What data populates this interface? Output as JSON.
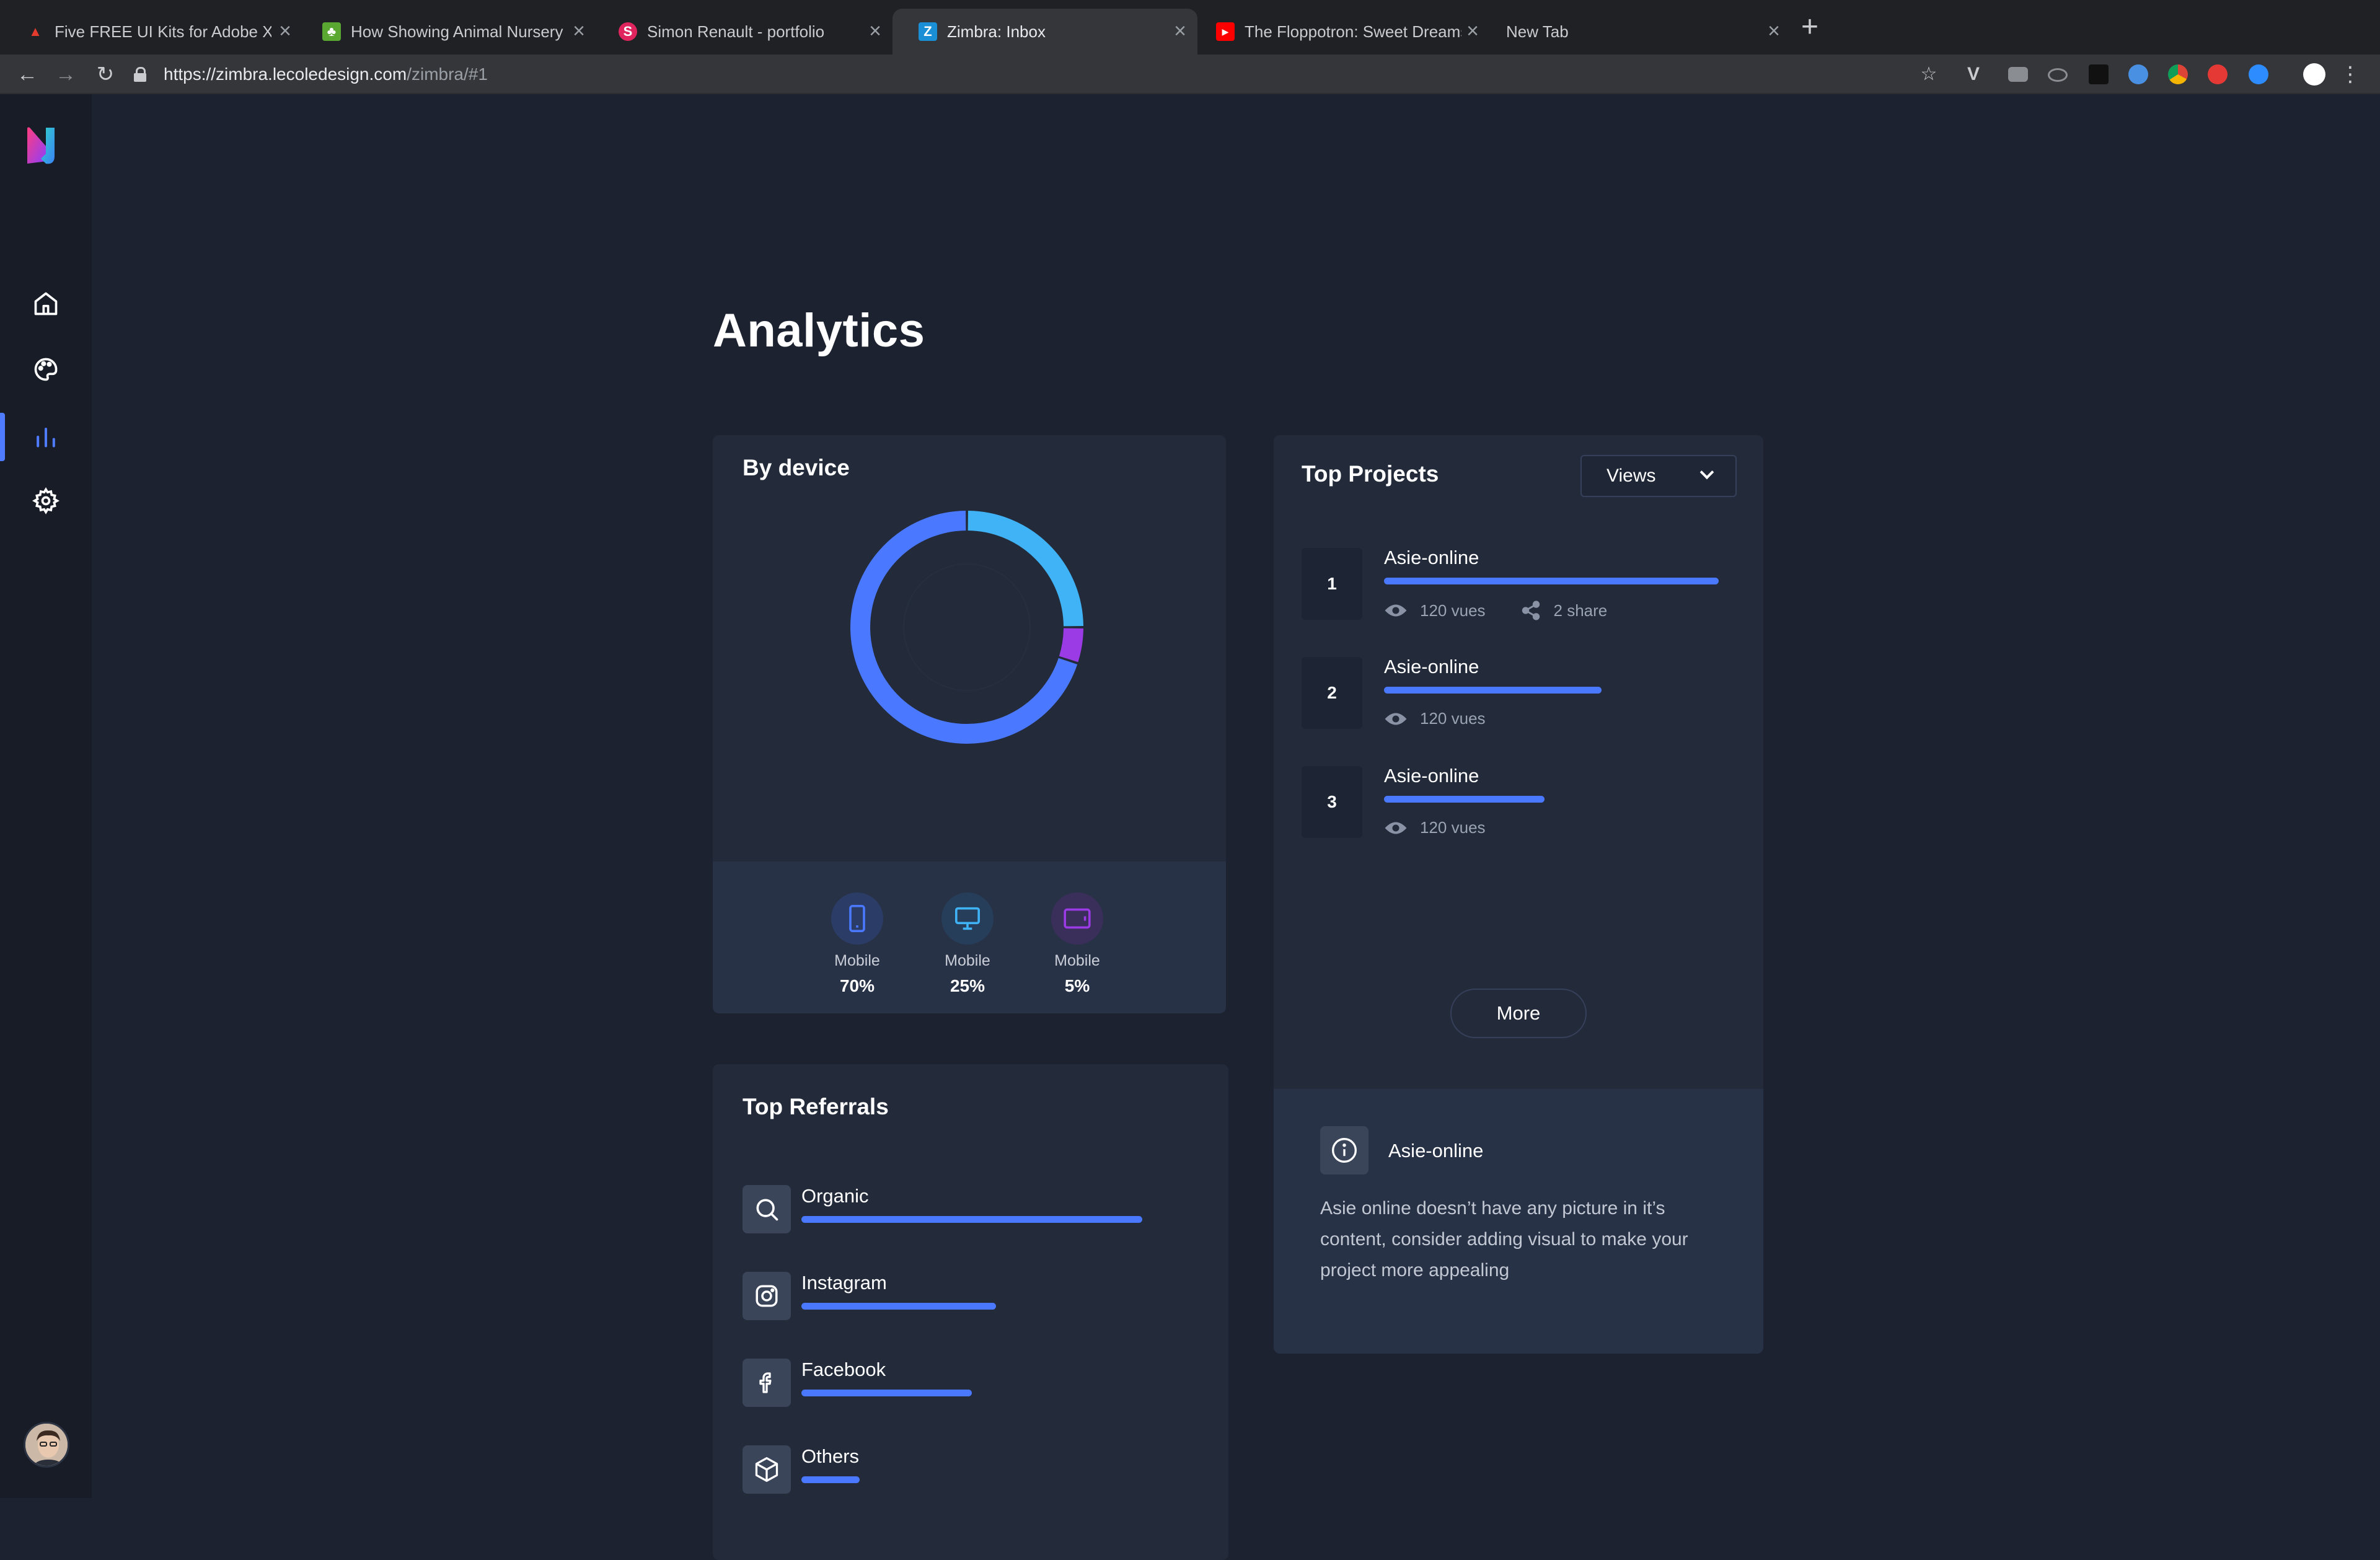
{
  "browser": {
    "tabs": [
      {
        "title": "Five FREE UI Kits for Adobe XD",
        "favicon": "adobe-icon",
        "color": "#e33b2e"
      },
      {
        "title": "How Showing Animal Nursery P",
        "favicon": "nursery-icon",
        "color": "#5aa832"
      },
      {
        "title": "Simon Renault - portfolio",
        "favicon": "s-icon",
        "color": "#e0245e"
      },
      {
        "title": "Zimbra: Inbox",
        "favicon": "zimbra-icon",
        "color": "#1a8fd6"
      },
      {
        "title": "The Floppotron: Sweet Dreams",
        "favicon": "youtube-icon",
        "color": "#ff0000"
      },
      {
        "title": "New Tab",
        "favicon": "",
        "color": ""
      }
    ],
    "active_tab": 3,
    "url_host": "https://zimbra.lecoledesign.com",
    "url_path": "/zimbra/#1"
  },
  "sidebar": {
    "items": [
      {
        "name": "home",
        "icon": "home-icon"
      },
      {
        "name": "design",
        "icon": "palette-icon"
      },
      {
        "name": "analytics",
        "icon": "bar-chart-icon",
        "active": true
      },
      {
        "name": "settings",
        "icon": "gear-icon"
      }
    ]
  },
  "page": {
    "title": "Analytics"
  },
  "by_device": {
    "title": "By device",
    "segments": [
      {
        "label": "Mobile",
        "value": "70%",
        "percent": 70,
        "icon": "mobile-icon",
        "color": "#4a78ff",
        "bg": "#2b3c66"
      },
      {
        "label": "Mobile",
        "value": "25%",
        "percent": 25,
        "icon": "desktop-icon",
        "color": "#3fb3f5",
        "bg": "#263e59"
      },
      {
        "label": "Mobile",
        "value": "5%",
        "percent": 5,
        "icon": "tablet-icon",
        "color": "#9b3be6",
        "bg": "#3a2e5a"
      }
    ]
  },
  "top_projects": {
    "title": "Top Projects",
    "select_value": "Views",
    "projects": [
      {
        "rank": "1",
        "name": "Asie-online",
        "views": "120 vues",
        "shares": "2 share",
        "progress": 1.0
      },
      {
        "rank": "2",
        "name": "Asie-online",
        "views": "120 vues",
        "progress": 0.65
      },
      {
        "rank": "3",
        "name": "Asie-online",
        "views": "120 vues",
        "progress": 0.48
      }
    ],
    "more_label": "More",
    "info": {
      "title": "Asie-online",
      "text": "Asie online doesn’t have any picture in it’s content, consider adding visual to make your project more appealing"
    }
  },
  "top_referrals": {
    "title": "Top Referrals",
    "items": [
      {
        "name": "Organic",
        "icon": "search-icon",
        "progress": 1.0
      },
      {
        "name": "Instagram",
        "icon": "instagram-icon",
        "progress": 0.57
      },
      {
        "name": "Facebook",
        "icon": "facebook-icon",
        "progress": 0.5
      },
      {
        "name": "Others",
        "icon": "box-icon",
        "progress": 0.17
      }
    ]
  },
  "colors": {
    "accent": "#4a78ff",
    "background": "#1c2230",
    "card": "#232b3b"
  }
}
